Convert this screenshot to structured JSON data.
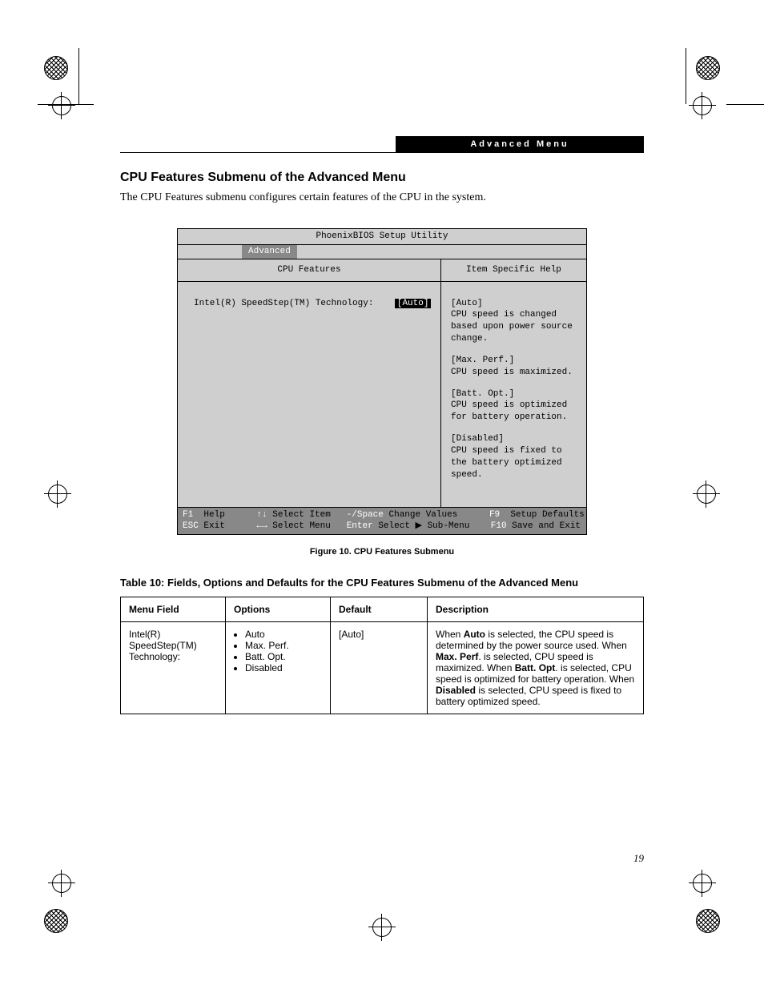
{
  "header": {
    "breadcrumb": "Advanced Menu"
  },
  "section": {
    "title": "CPU Features Submenu of the Advanced Menu",
    "intro": "The CPU Features submenu configures certain features of the CPU in the system."
  },
  "bios": {
    "title": "PhoenixBIOS Setup Utility",
    "tab": "Advanced",
    "left_header": "CPU Features",
    "right_header": "Item Specific Help",
    "field_label": "Intel(R) SpeedStep(TM) Technology:",
    "field_value": "[Auto]",
    "help": [
      {
        "head": "[Auto]",
        "body": "CPU speed is changed based upon power source change."
      },
      {
        "head": "[Max. Perf.]",
        "body": "CPU speed is maximized."
      },
      {
        "head": "[Batt. Opt.]",
        "body": "CPU speed is optimized for battery operation."
      },
      {
        "head": "[Disabled]",
        "body": "CPU speed is fixed to the battery optimized speed."
      }
    ],
    "bottom": {
      "f1": "F1",
      "help": "Help",
      "updown": "↑↓",
      "select_item": "Select Item",
      "minus_space": "-/Space",
      "change_values": "Change Values",
      "f9": "F9",
      "setup_defaults": "Setup Defaults",
      "esc": "ESC",
      "exit": "Exit",
      "leftright": "←→",
      "select_menu": "Select Menu",
      "enter": "Enter",
      "select_sub": "Select ▶ Sub-Menu",
      "f10": "F10",
      "save_exit": "Save and Exit"
    }
  },
  "figcap": "Figure 10.  CPU Features Submenu",
  "table_title": "Table 10: Fields, Options and Defaults for the CPU Features Submenu of the Advanced Menu",
  "table": {
    "headers": {
      "menu_field": "Menu Field",
      "options": "Options",
      "default": "Default",
      "description": "Description"
    },
    "row": {
      "menu_field": "Intel(R) SpeedStep(TM) Technology:",
      "options": [
        "Auto",
        "Max. Perf.",
        "Batt. Opt.",
        "Disabled"
      ],
      "default": "[Auto]",
      "desc_parts": {
        "p1": "When ",
        "b1": "Auto",
        "p2": " is selected, the CPU speed is determined by the power source used. When ",
        "b2": "Max. Perf",
        "p3": ". is selected, CPU speed is maximized. When ",
        "b3": "Batt. Opt",
        "p4": ". is selected, CPU speed is optimized for battery operation. When ",
        "b4": "Disabled",
        "p5": " is selected, CPU speed is fixed to battery optimized speed."
      }
    }
  },
  "page_number": "19"
}
